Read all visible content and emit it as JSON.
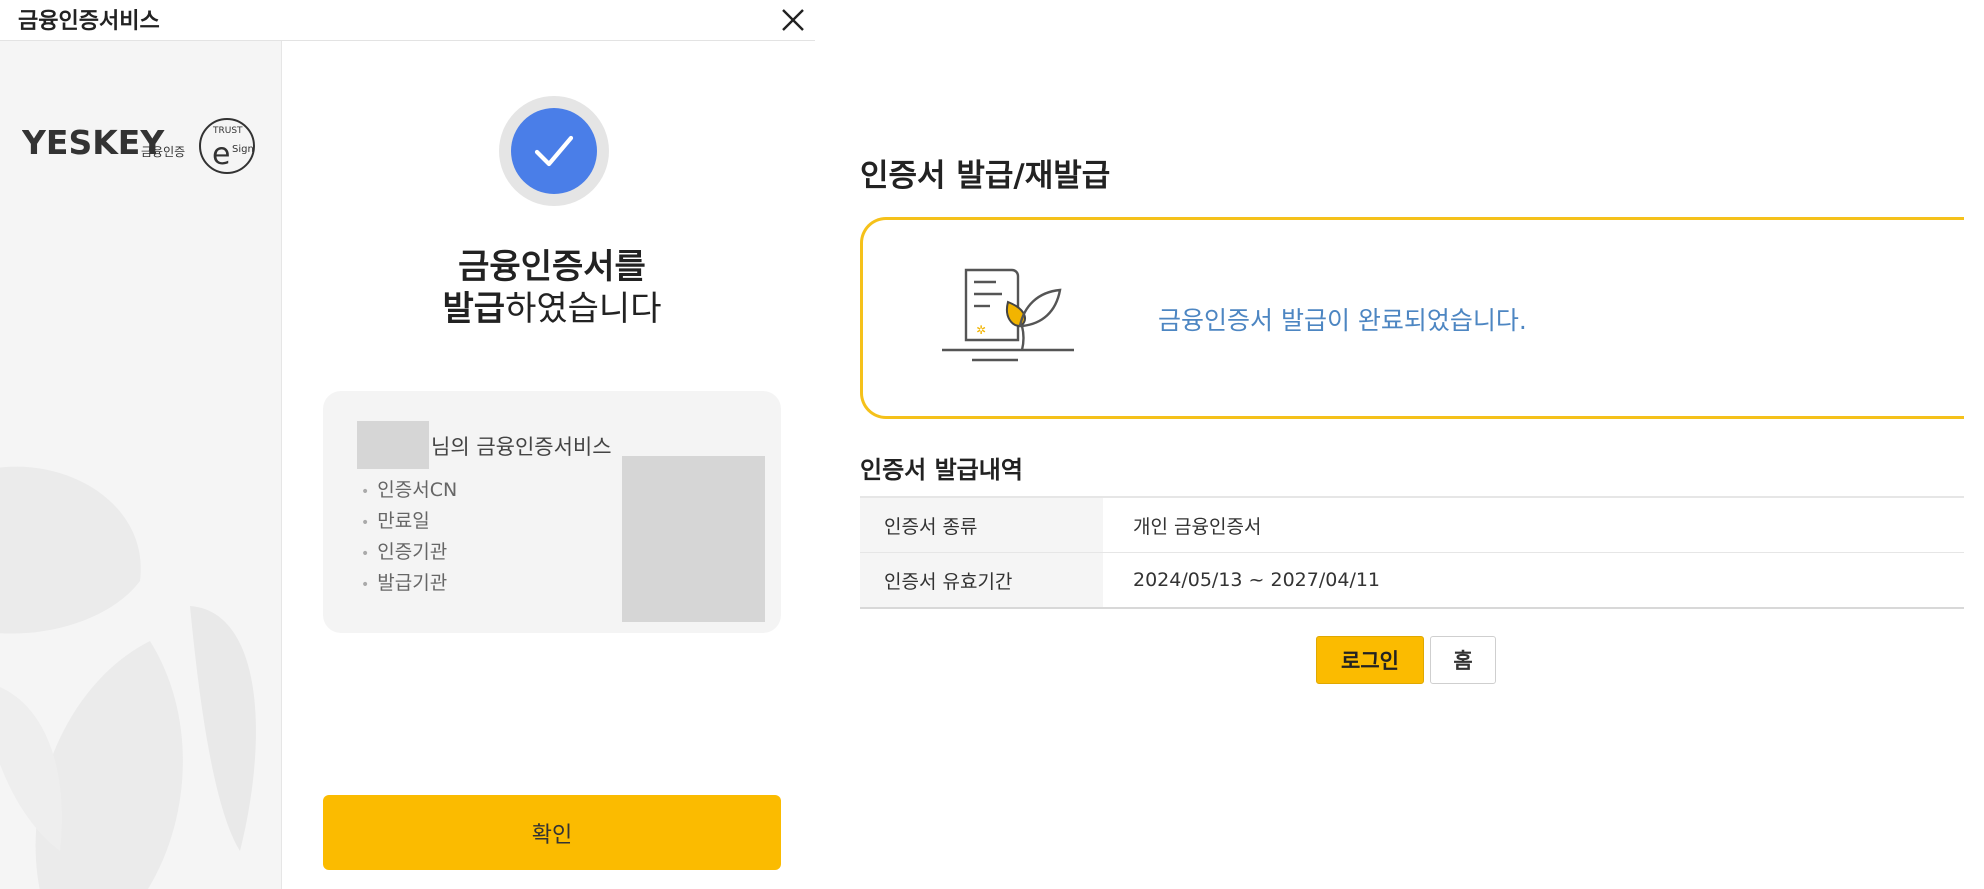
{
  "dialog": {
    "title": "금융인증서비스",
    "logo": {
      "brand": "YESKEY",
      "sub": "금융인증",
      "badge_top": "TRUST",
      "badge_mark": "e",
      "badge_sub": "Sign"
    },
    "headline": {
      "line1": "금융인증서를",
      "line2_bold": "발급",
      "line2_rest": "하였습니다"
    },
    "card": {
      "title": "님의 금융인증서비스",
      "items": [
        "인증서CN",
        "만료일",
        "인증기관",
        "발급기관"
      ]
    },
    "confirm_label": "확인"
  },
  "page": {
    "title": "인증서 발급/재발급",
    "notice": "금융인증서 발급이 완료되었습니다.",
    "history_title": "인증서 발급내역",
    "rows": [
      {
        "label": "인증서 종류",
        "value": "개인 금융인증서"
      },
      {
        "label": "인증서 유효기간",
        "value": "2024/05/13 ~ 2027/04/11"
      }
    ],
    "login_label": "로그인",
    "home_label": "홈"
  },
  "colors": {
    "accent_yellow": "#fbbb00",
    "check_blue": "#4a7ee8",
    "notice_blue": "#4d86c2"
  },
  "icons": [
    "close-icon",
    "check-icon",
    "certificate-leaf-icon"
  ]
}
